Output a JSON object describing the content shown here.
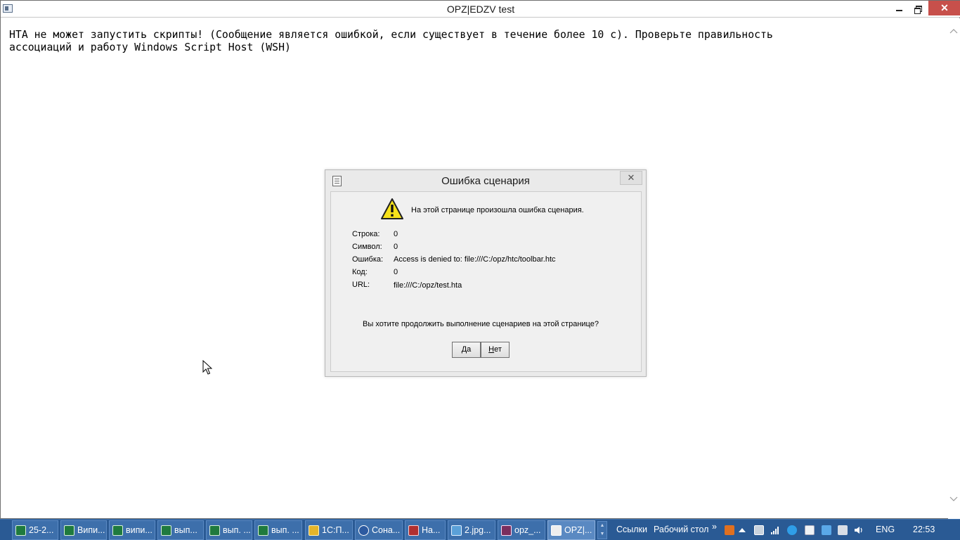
{
  "window": {
    "title": "OPZ|EDZV test",
    "close_glyph": "✕"
  },
  "content": {
    "line1": "HTA не может запустить скрипты! (Сообщение является ошибкой, если существует в течение более 10 с). Проверьте правильность",
    "line2": "ассоциаций и работу Windows Script Host (WSH)"
  },
  "dialog": {
    "title": "Ошибка сценария",
    "close_glyph": "✕",
    "message": "На этой странице произошла ошибка сценария.",
    "details": [
      {
        "label": "Строка:",
        "value": "0"
      },
      {
        "label": "Символ:",
        "value": "0"
      },
      {
        "label": "Ошибка:",
        "value": "Access is denied to: file:///C:/opz/htc/toolbar.htc"
      },
      {
        "label": "Код:",
        "value": "0"
      },
      {
        "label": "URL:",
        "value": "file:///C:/opz/test.hta"
      }
    ],
    "question": "Вы хотите продолжить выполнение сценариев на этой странице?",
    "yes_label": "Да",
    "yes_access_key": "Д",
    "yes_rest": "а",
    "no_label": "Нет",
    "no_access_key": "Н",
    "no_rest": "ет"
  },
  "taskbar": {
    "tasks": [
      {
        "label": "25-2...",
        "icon": "excel-icon"
      },
      {
        "label": "Випи...",
        "icon": "excel-icon"
      },
      {
        "label": "випи...",
        "icon": "excel-icon"
      },
      {
        "label": "вып...",
        "icon": "excel-icon"
      },
      {
        "label": "вып. ...",
        "icon": "excel-icon"
      },
      {
        "label": "вып. ...",
        "icon": "excel-icon"
      },
      {
        "label": "1С:П...",
        "icon": "1c-icon"
      },
      {
        "label": "Сона...",
        "icon": "sona-icon"
      },
      {
        "label": "На...",
        "icon": "app-icon"
      },
      {
        "label": "2.jpg...",
        "icon": "image-icon"
      },
      {
        "label": "opz_...",
        "icon": "archive-icon"
      },
      {
        "label": "OPZ|...",
        "icon": "hta-window-icon"
      }
    ],
    "links_label": "Ссылки",
    "desktop_label": "Рабочий стол",
    "overflow_glyph": "»",
    "language": "ENG",
    "time": "22:53"
  }
}
